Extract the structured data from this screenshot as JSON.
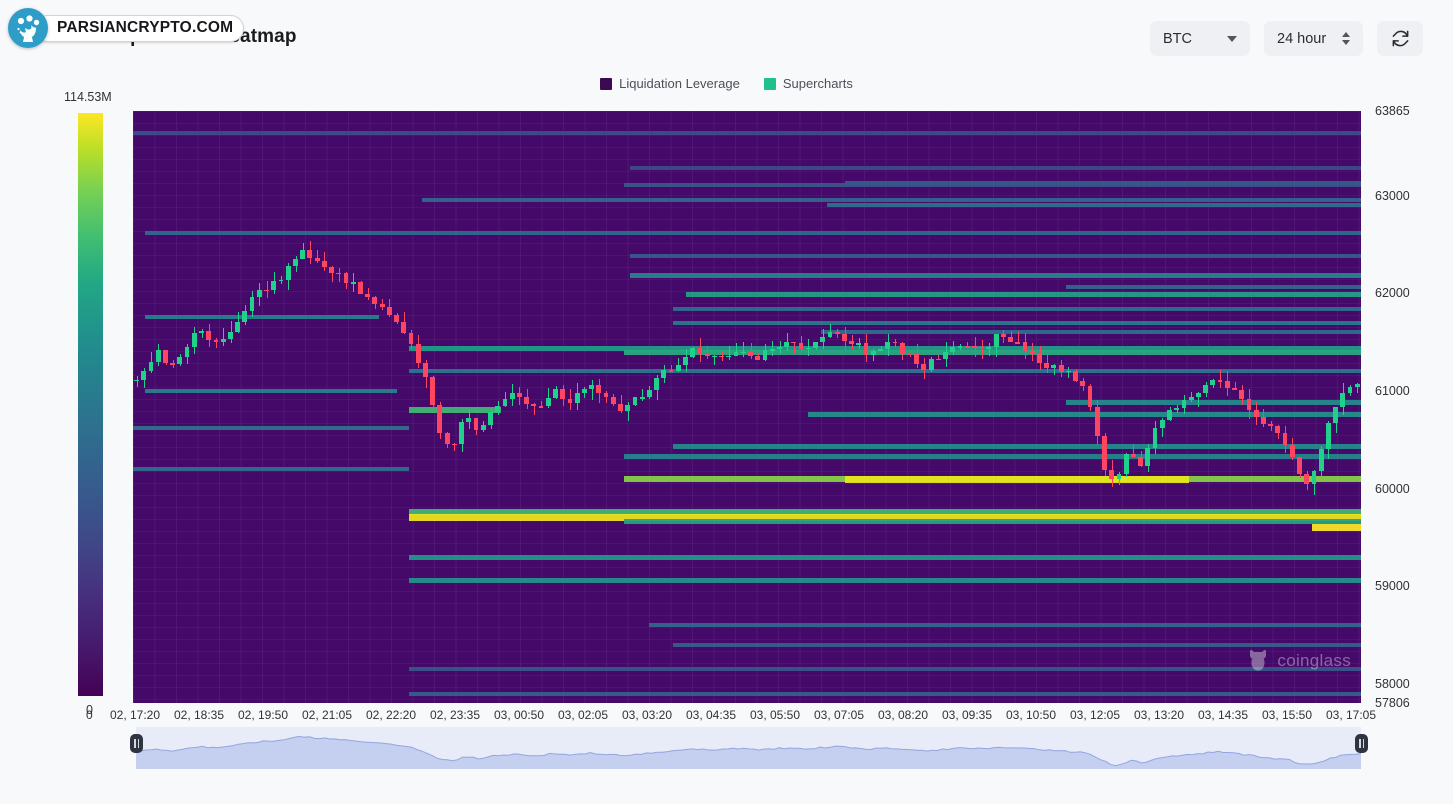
{
  "header": {
    "title": "BTC Liquidation Heatmap",
    "symbol_select": {
      "value": "BTC",
      "icon": "chevron-down-icon"
    },
    "range_select": {
      "value": "24 hour",
      "icon": "chevron-up-down-icon"
    },
    "refresh_button": {
      "icon": "refresh-icon",
      "label": ""
    }
  },
  "watermark": {
    "text": "PARSIANCRYPTO.COM",
    "logo_name": "parsiancrypto-logo-icon",
    "brand_color": "#2e9ec9"
  },
  "legend": {
    "items": [
      {
        "label": "Liquidation Leverage",
        "color": "#3b0a52"
      },
      {
        "label": "Supercharts",
        "color": "#21c08a"
      }
    ]
  },
  "colorbar": {
    "max_label": "114.53M",
    "min_label": "0",
    "colormap": "viridis",
    "stops": [
      "#440154",
      "#414487",
      "#2a788e",
      "#22a884",
      "#7ad151",
      "#fde725"
    ]
  },
  "source_watermark": {
    "text": "coinglass",
    "icon": "bull-icon"
  },
  "chart_data": {
    "type": "heatmap",
    "title": "BTC Liquidation Heatmap",
    "xlabel": "",
    "ylabel": "",
    "legend_position": "top-center",
    "grid": true,
    "colorbar": {
      "label": "Liquidation Leverage (USD)",
      "min": 0,
      "max": 114530000,
      "max_text": "114.53M"
    },
    "ylim": [
      57806,
      63865
    ],
    "y_ticks": [
      "63865",
      "63000",
      "62000",
      "61000",
      "60000",
      "59000",
      "58000",
      "57806"
    ],
    "y_tick_values": [
      63865,
      63000,
      62000,
      61000,
      60000,
      59000,
      58000,
      57806
    ],
    "x_ticks": [
      "02, 17:20",
      "02, 18:35",
      "02, 19:50",
      "02, 21:05",
      "02, 22:20",
      "02, 23:35",
      "03, 00:50",
      "03, 02:05",
      "03, 03:20",
      "03, 04:35",
      "03, 05:50",
      "03, 07:05",
      "03, 08:20",
      "03, 09:35",
      "03, 10:50",
      "03, 12:05",
      "03, 13:20",
      "03, 14:35",
      "03, 15:50",
      "03, 17:05"
    ],
    "bands": [
      {
        "price": 63640,
        "x_start": 0.0,
        "x_end": 1.0,
        "value_norm": 0.22
      },
      {
        "price": 63280,
        "x_start": 0.405,
        "x_end": 1.0,
        "value_norm": 0.2
      },
      {
        "price": 63130,
        "x_start": 0.58,
        "x_end": 1.0,
        "value_norm": 0.26
      },
      {
        "price": 63105,
        "x_start": 0.4,
        "x_end": 1.0,
        "value_norm": 0.24
      },
      {
        "price": 62950,
        "x_start": 0.235,
        "x_end": 1.0,
        "value_norm": 0.3
      },
      {
        "price": 62905,
        "x_start": 0.565,
        "x_end": 1.0,
        "value_norm": 0.34
      },
      {
        "price": 62620,
        "x_start": 0.01,
        "x_end": 1.0,
        "value_norm": 0.31
      },
      {
        "price": 62380,
        "x_start": 0.405,
        "x_end": 1.0,
        "value_norm": 0.26
      },
      {
        "price": 62185,
        "x_start": 0.405,
        "x_end": 1.0,
        "value_norm": 0.42
      },
      {
        "price": 62060,
        "x_start": 0.76,
        "x_end": 1.0,
        "value_norm": 0.3
      },
      {
        "price": 61990,
        "x_start": 0.45,
        "x_end": 1.0,
        "value_norm": 0.52
      },
      {
        "price": 61840,
        "x_start": 0.44,
        "x_end": 1.0,
        "value_norm": 0.33
      },
      {
        "price": 61760,
        "x_start": 0.01,
        "x_end": 0.2,
        "value_norm": 0.4
      },
      {
        "price": 61700,
        "x_start": 0.44,
        "x_end": 1.0,
        "value_norm": 0.38
      },
      {
        "price": 61600,
        "x_start": 0.56,
        "x_end": 1.0,
        "value_norm": 0.33
      },
      {
        "price": 61430,
        "x_start": 0.225,
        "x_end": 1.0,
        "value_norm": 0.5
      },
      {
        "price": 61390,
        "x_start": 0.4,
        "x_end": 1.0,
        "value_norm": 0.55
      },
      {
        "price": 61200,
        "x_start": 0.225,
        "x_end": 1.0,
        "value_norm": 0.36
      },
      {
        "price": 61000,
        "x_start": 0.01,
        "x_end": 0.215,
        "value_norm": 0.4
      },
      {
        "price": 60880,
        "x_start": 0.76,
        "x_end": 1.0,
        "value_norm": 0.44
      },
      {
        "price": 60800,
        "x_start": 0.225,
        "x_end": 0.3,
        "value_norm": 0.62
      },
      {
        "price": 60760,
        "x_start": 0.55,
        "x_end": 1.0,
        "value_norm": 0.46
      },
      {
        "price": 60620,
        "x_start": 0.0,
        "x_end": 0.225,
        "value_norm": 0.34
      },
      {
        "price": 60430,
        "x_start": 0.44,
        "x_end": 1.0,
        "value_norm": 0.44
      },
      {
        "price": 60330,
        "x_start": 0.4,
        "x_end": 1.0,
        "value_norm": 0.42
      },
      {
        "price": 60200,
        "x_start": 0.0,
        "x_end": 0.225,
        "value_norm": 0.33
      },
      {
        "price": 60100,
        "x_start": 0.4,
        "x_end": 1.0,
        "value_norm": 0.74
      },
      {
        "price": 60090,
        "x_start": 0.58,
        "x_end": 0.86,
        "value_norm": 0.92
      },
      {
        "price": 59760,
        "x_start": 0.225,
        "x_end": 1.0,
        "value_norm": 0.62
      },
      {
        "price": 59700,
        "x_start": 0.225,
        "x_end": 1.0,
        "value_norm": 0.95
      },
      {
        "price": 59660,
        "x_start": 0.4,
        "x_end": 1.0,
        "value_norm": 0.52
      },
      {
        "price": 59600,
        "x_start": 0.96,
        "x_end": 1.0,
        "value_norm": 1.0
      },
      {
        "price": 59300,
        "x_start": 0.225,
        "x_end": 1.0,
        "value_norm": 0.48
      },
      {
        "price": 59060,
        "x_start": 0.225,
        "x_end": 1.0,
        "value_norm": 0.46
      },
      {
        "price": 58600,
        "x_start": 0.42,
        "x_end": 1.0,
        "value_norm": 0.3
      },
      {
        "price": 58400,
        "x_start": 0.44,
        "x_end": 1.0,
        "value_norm": 0.27
      },
      {
        "price": 58150,
        "x_start": 0.225,
        "x_end": 1.0,
        "value_norm": 0.24
      },
      {
        "price": 57900,
        "x_start": 0.225,
        "x_end": 1.0,
        "value_norm": 0.28
      }
    ],
    "candles_note": "OHLC candlestick overlay, green rising / red falling",
    "candle_colors": {
      "up": "#1fd18a",
      "down": "#ff4560"
    }
  },
  "brush": {
    "left_handle": "brush-handle-left",
    "right_handle": "brush-handle-right",
    "fill_color": "#c5cff0"
  }
}
